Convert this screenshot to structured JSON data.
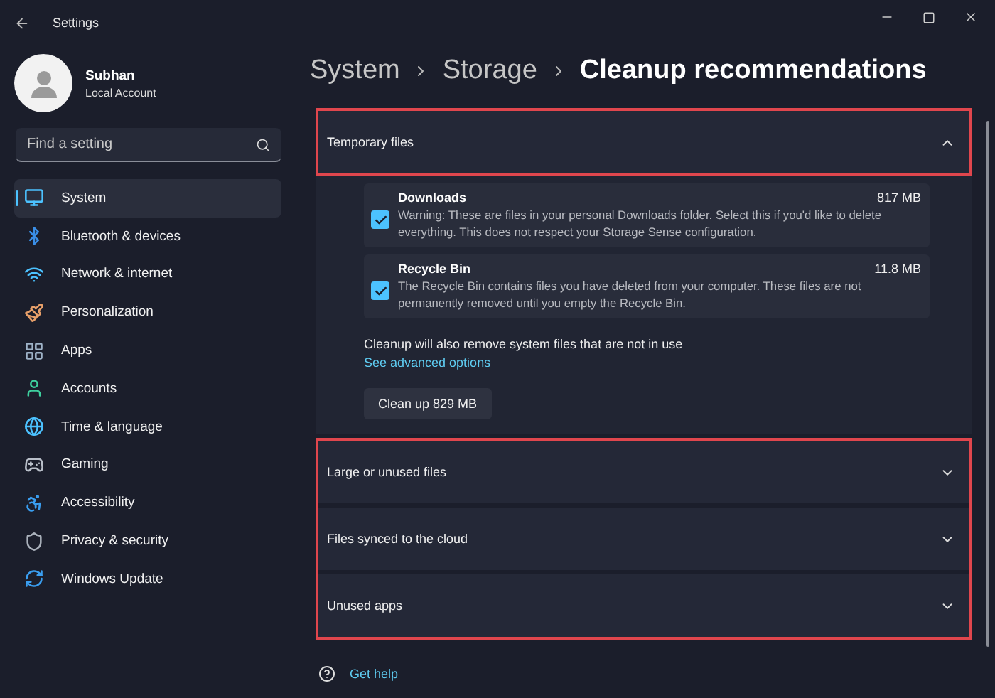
{
  "window": {
    "title": "Settings"
  },
  "profile": {
    "name": "Subhan",
    "account": "Local Account"
  },
  "search": {
    "placeholder": "Find a setting"
  },
  "sidebar": {
    "items": [
      {
        "label": "System",
        "selected": true
      },
      {
        "label": "Bluetooth & devices",
        "selected": false
      },
      {
        "label": "Network & internet",
        "selected": false
      },
      {
        "label": "Personalization",
        "selected": false
      },
      {
        "label": "Apps",
        "selected": false
      },
      {
        "label": "Accounts",
        "selected": false
      },
      {
        "label": "Time & language",
        "selected": false
      },
      {
        "label": "Gaming",
        "selected": false
      },
      {
        "label": "Accessibility",
        "selected": false
      },
      {
        "label": "Privacy & security",
        "selected": false
      },
      {
        "label": "Windows Update",
        "selected": false
      }
    ]
  },
  "breadcrumb": [
    "System",
    "Storage",
    "Cleanup recommendations"
  ],
  "panels": [
    {
      "highlighted": true,
      "sections": [
        {
          "title": "Temporary files",
          "expanded": true,
          "items": [
            {
              "name": "Downloads",
              "size": "817 MB",
              "checked": true,
              "description": "Warning: These are files in your personal Downloads folder. Select this if you'd like to delete everything. This does not respect your Storage Sense configuration."
            },
            {
              "name": "Recycle Bin",
              "size": "11.8 MB",
              "checked": true,
              "description": "The Recycle Bin contains files you have deleted from your computer. These files are not permanently removed until you empty the Recycle Bin."
            }
          ],
          "note": "Cleanup will also remove system files that are not in use",
          "link": "See advanced options",
          "button": "Clean up 829 MB"
        }
      ]
    },
    {
      "highlighted": true,
      "sections": [
        {
          "title": "Large or unused files",
          "expanded": false
        },
        {
          "title": "Files synced to the cloud",
          "expanded": false
        },
        {
          "title": "Unused apps",
          "expanded": false
        }
      ]
    }
  ],
  "help_link": "Get help"
}
